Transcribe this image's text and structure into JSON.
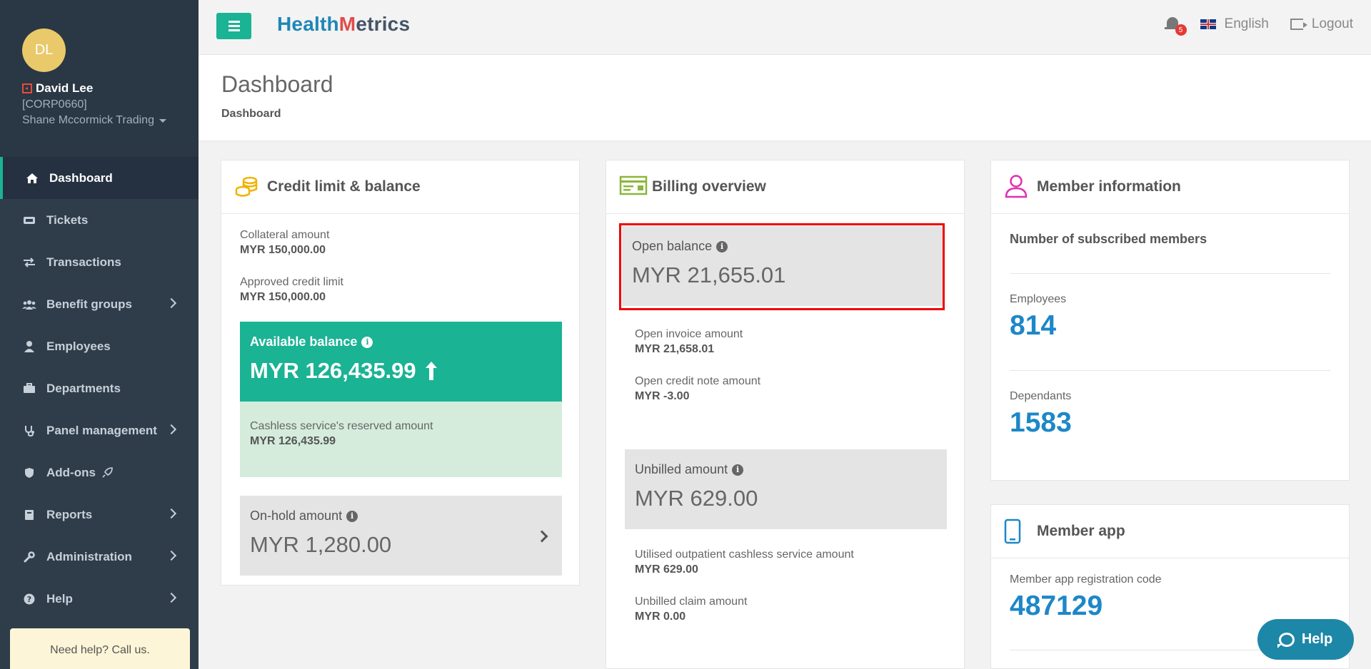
{
  "app": {
    "brand_part1": "Health",
    "brand_m": "M",
    "brand_part2": "etrics"
  },
  "user": {
    "initials": "DL",
    "name": "David Lee",
    "code": "[CORP0660]",
    "company": "Shane Mccormick Trading"
  },
  "sidebar": {
    "items": [
      {
        "label": "Dashboard",
        "icon": "home-icon"
      },
      {
        "label": "Tickets",
        "icon": "ticket-icon"
      },
      {
        "label": "Transactions",
        "icon": "exchange-icon"
      },
      {
        "label": "Benefit groups",
        "icon": "users-icon"
      },
      {
        "label": "Employees",
        "icon": "user-icon"
      },
      {
        "label": "Departments",
        "icon": "briefcase-icon"
      },
      {
        "label": "Panel management",
        "icon": "stethoscope-icon"
      },
      {
        "label": "Add-ons",
        "icon": "shield-icon"
      },
      {
        "label": "Reports",
        "icon": "book-icon"
      },
      {
        "label": "Administration",
        "icon": "wrench-icon"
      },
      {
        "label": "Help",
        "icon": "question-icon"
      }
    ],
    "help_card": "Need help? Call us."
  },
  "topbar": {
    "notification_count": "5",
    "language": "English",
    "logout": "Logout"
  },
  "page": {
    "title": "Dashboard",
    "breadcrumb": "Dashboard"
  },
  "credit": {
    "title": "Credit limit & balance",
    "collateral_label": "Collateral amount",
    "collateral_value": "MYR 150,000.00",
    "approved_label": "Approved credit limit",
    "approved_value": "MYR 150,000.00",
    "available_label": "Available balance",
    "available_value": "MYR 126,435.99",
    "reserved_label": "Cashless service's reserved amount",
    "reserved_value": "MYR 126,435.99",
    "onhold_label": "On-hold amount",
    "onhold_value": "MYR 1,280.00"
  },
  "billing": {
    "title": "Billing overview",
    "open_balance_label": "Open balance",
    "open_balance_value": "MYR 21,655.01",
    "open_invoice_label": "Open invoice amount",
    "open_invoice_value": "MYR 21,658.01",
    "open_credit_label": "Open credit note amount",
    "open_credit_value": "MYR -3.00",
    "unbilled_label": "Unbilled amount",
    "unbilled_value": "MYR 629.00",
    "utilised_label": "Utilised outpatient cashless service amount",
    "utilised_value": "MYR 629.00",
    "unbilled_claim_label": "Unbilled claim amount",
    "unbilled_claim_value": "MYR 0.00"
  },
  "member": {
    "title": "Member information",
    "subtitle": "Number of subscribed members",
    "employees_label": "Employees",
    "employees_value": "814",
    "dependants_label": "Dependants",
    "dependants_value": "1583"
  },
  "member_app": {
    "title": "Member app",
    "code_label": "Member app registration code",
    "code_value": "487129"
  },
  "help_button": "Help",
  "colors": {
    "accent": "#1ab394",
    "sidebar": "#2f3d4a",
    "number_blue": "#1d87c8",
    "highlight": "#e00000"
  }
}
